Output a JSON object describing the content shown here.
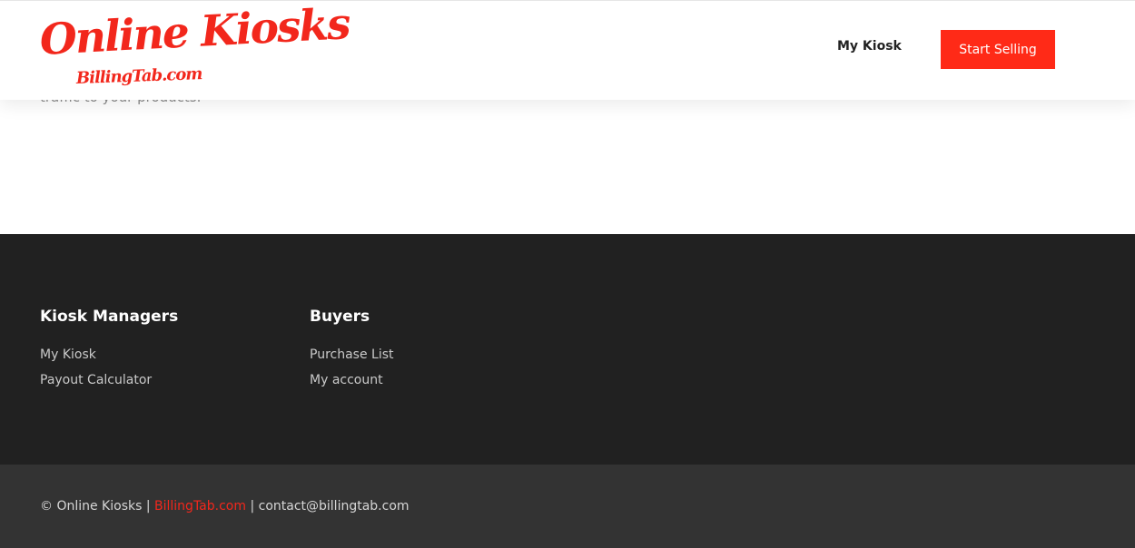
{
  "header": {
    "logo_main": "Online Kiosks",
    "logo_sub": "BillingTab.com",
    "nav_my_kiosk": "My Kiosk",
    "cta_label": "Start Selling"
  },
  "content": {
    "fragment_text": "traffic to your products."
  },
  "footer": {
    "columns": [
      {
        "heading": "Kiosk Managers",
        "links": [
          "My Kiosk",
          "Payout Calculator"
        ]
      },
      {
        "heading": "Buyers",
        "links": [
          "Purchase List",
          "My account"
        ]
      }
    ]
  },
  "bottom_bar": {
    "copyright_prefix": "© Online Kiosks | ",
    "brand_link": "BillingTab.com",
    "separator": " | ",
    "email": "contact@billingtab.com"
  },
  "colors": {
    "accent": "#ff2a17",
    "footer_bg": "#212121",
    "bottom_bar_bg": "#333333"
  }
}
